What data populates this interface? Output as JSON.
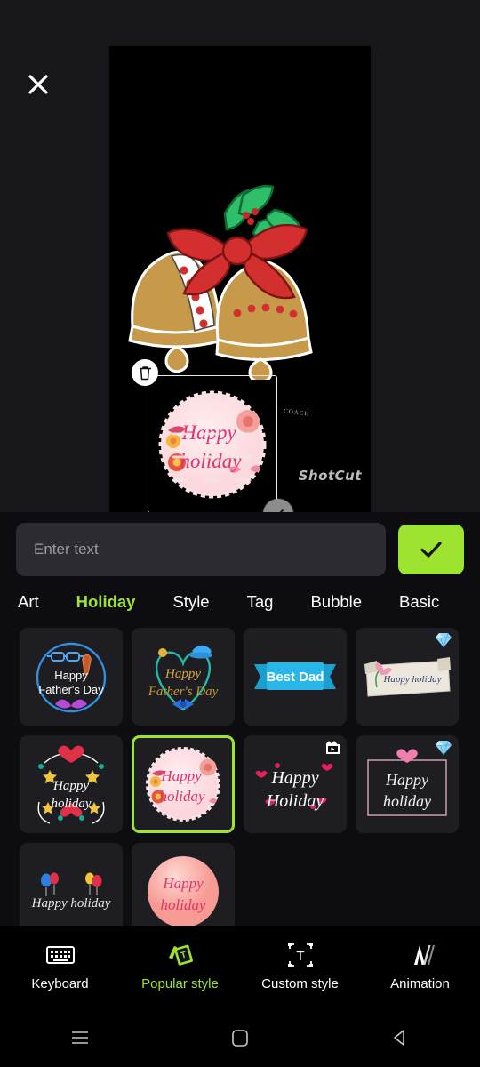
{
  "app": {
    "watermark": "ShotCut",
    "coach_mark": "COACH"
  },
  "editor": {
    "close_icon": "close-icon",
    "delete_handle_icon": "trash-icon",
    "resize_handle_icon": "resize-arrow-icon",
    "selected_sticker_text_line1": "Happy",
    "selected_sticker_text_line2": "holiday"
  },
  "input": {
    "placeholder": "Enter text",
    "value": "",
    "confirm_icon": "check-icon",
    "confirm_color": "#9de330"
  },
  "tabs": [
    {
      "label": "Art",
      "active": false
    },
    {
      "label": "Holiday",
      "active": true
    },
    {
      "label": "Style",
      "active": false
    },
    {
      "label": "Tag",
      "active": false
    },
    {
      "label": "Bubble",
      "active": false
    },
    {
      "label": "Basic",
      "active": false
    }
  ],
  "stickers": [
    {
      "id": "happy-fathers-day-neon",
      "label": "Happy Father's Day",
      "badge": "none",
      "selected": false
    },
    {
      "id": "happy-fathers-day-heart",
      "label": "Happy Father's Day",
      "badge": "none",
      "selected": false
    },
    {
      "id": "best-dad-ribbon",
      "label": "Best Dad",
      "badge": "none",
      "selected": false
    },
    {
      "id": "happy-holiday-note",
      "label": "Happy holiday",
      "badge": "gem",
      "selected": false
    },
    {
      "id": "happy-holiday-doodle",
      "label": "Happy holiday",
      "badge": "none",
      "selected": false
    },
    {
      "id": "happy-holiday-floral-circle",
      "label": "Happy holiday",
      "badge": "none",
      "selected": true
    },
    {
      "id": "happy-holiday-script-hearts",
      "label": "Happy Holiday",
      "badge": "video",
      "selected": false
    },
    {
      "id": "happy-holiday-frame",
      "label": "Happy holiday",
      "badge": "gem",
      "selected": false
    },
    {
      "id": "happy-holiday-balloons",
      "label": "Happy holiday",
      "badge": "none",
      "selected": false
    },
    {
      "id": "happy-holiday-pink-ball",
      "label": "Happy holiday",
      "badge": "none",
      "selected": false
    }
  ],
  "toolbar": [
    {
      "label": "Keyboard",
      "icon": "keyboard-icon",
      "active": false
    },
    {
      "label": "Popular style",
      "icon": "popular-style-icon",
      "active": true
    },
    {
      "label": "Custom style",
      "icon": "custom-style-icon",
      "active": false
    },
    {
      "label": "Animation",
      "icon": "animation-icon",
      "active": false
    }
  ],
  "navbar": [
    {
      "icon": "recents-icon"
    },
    {
      "icon": "home-icon"
    },
    {
      "icon": "back-icon"
    }
  ],
  "colors": {
    "accent": "#9de330",
    "panel_bg": "#0d0d11",
    "tile_bg": "#1d1d22",
    "input_bg": "#2b2b31"
  }
}
